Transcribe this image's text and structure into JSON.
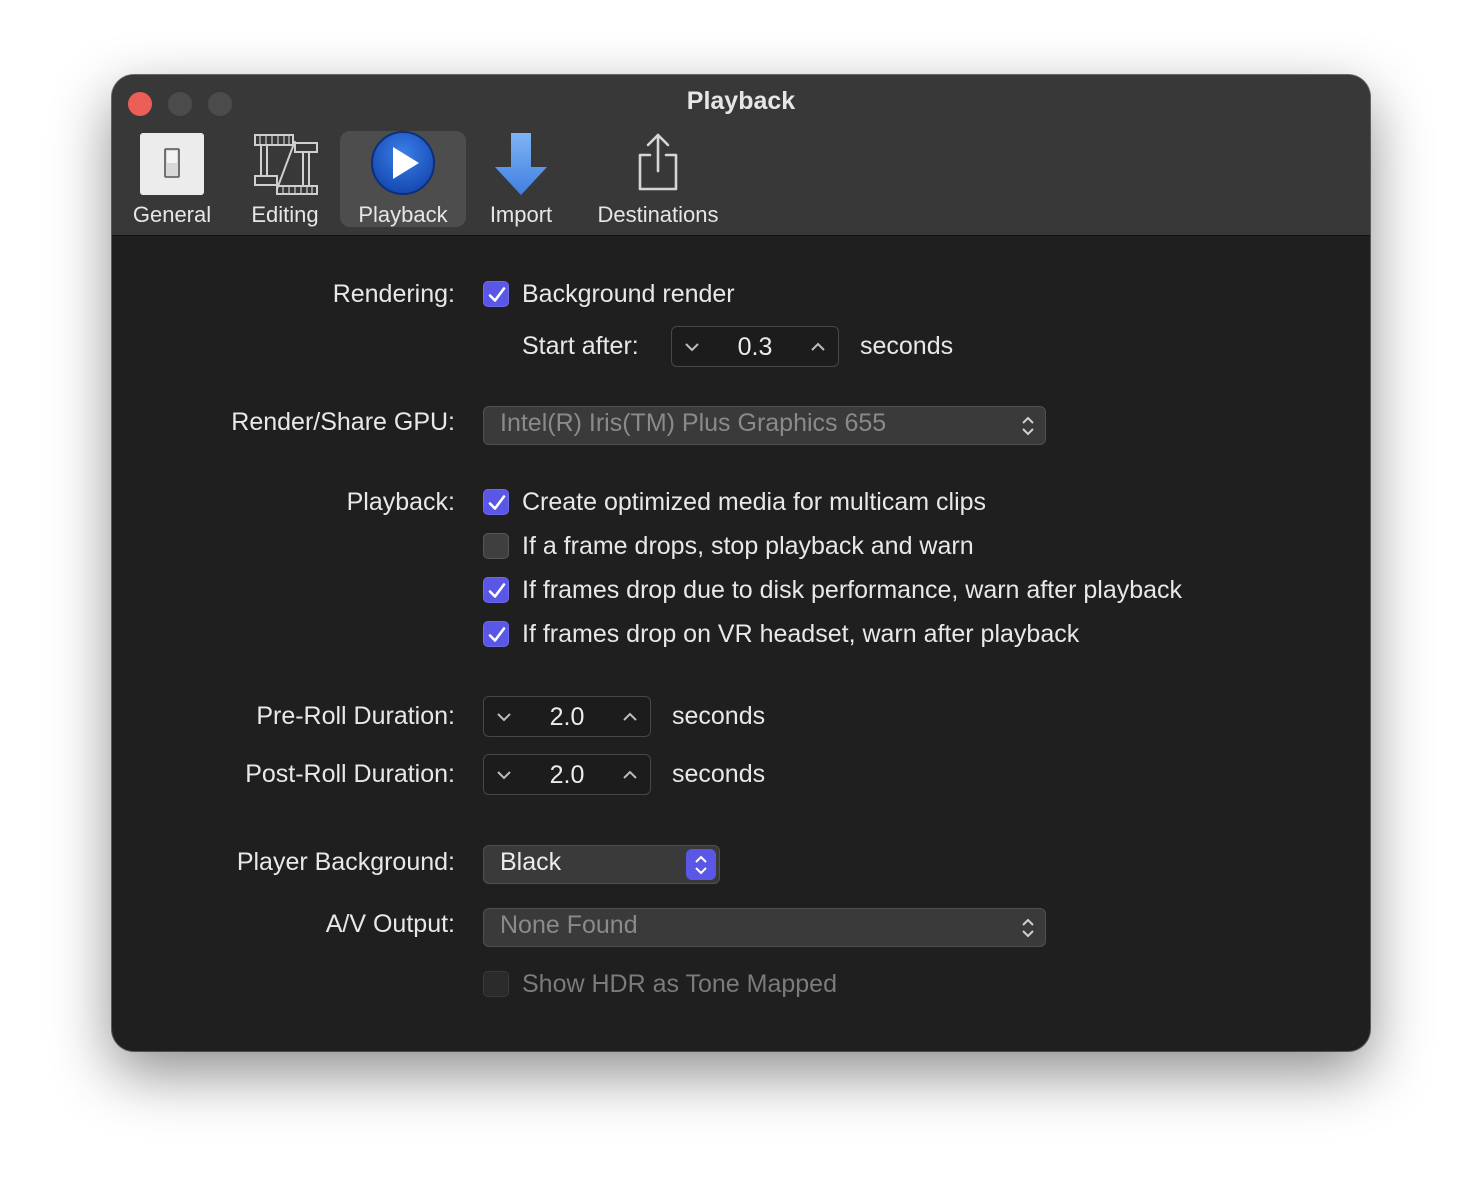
{
  "window": {
    "title": "Playback"
  },
  "toolbar": {
    "tabs": [
      {
        "label": "General",
        "icon": "switch-icon"
      },
      {
        "label": "Editing",
        "icon": "film-editing-icon"
      },
      {
        "label": "Playback",
        "icon": "play-icon",
        "selected": true
      },
      {
        "label": "Import",
        "icon": "download-arrow-icon"
      },
      {
        "label": "Destinations",
        "icon": "share-icon"
      }
    ]
  },
  "rendering": {
    "label": "Rendering:",
    "background_render": {
      "label": "Background render",
      "checked": true
    },
    "start_after": {
      "label": "Start after:",
      "value": "0.3",
      "unit": "seconds"
    }
  },
  "gpu": {
    "label": "Render/Share GPU:",
    "value": "Intel(R) Iris(TM) Plus Graphics 655",
    "enabled": false
  },
  "playback": {
    "label": "Playback:",
    "options": [
      {
        "label": "Create optimized media for multicam clips",
        "checked": true
      },
      {
        "label": "If a frame drops, stop playback and warn",
        "checked": false
      },
      {
        "label": "If frames drop due to disk performance, warn after playback",
        "checked": true
      },
      {
        "label": "If frames drop on VR headset, warn after playback",
        "checked": true
      }
    ]
  },
  "pre_roll": {
    "label": "Pre-Roll Duration:",
    "value": "2.0",
    "unit": "seconds"
  },
  "post_roll": {
    "label": "Post-Roll Duration:",
    "value": "2.0",
    "unit": "seconds"
  },
  "player_background": {
    "label": "Player Background:",
    "value": "Black"
  },
  "av_output": {
    "label": "A/V Output:",
    "value": "None Found",
    "enabled": false,
    "hdr": {
      "label": "Show HDR as Tone Mapped",
      "checked": false,
      "enabled": false
    }
  },
  "colors": {
    "accent": "#5b57e6",
    "close": "#ec5f57",
    "window_bg": "#1f1f1f",
    "titlebar_bg": "#383838"
  }
}
